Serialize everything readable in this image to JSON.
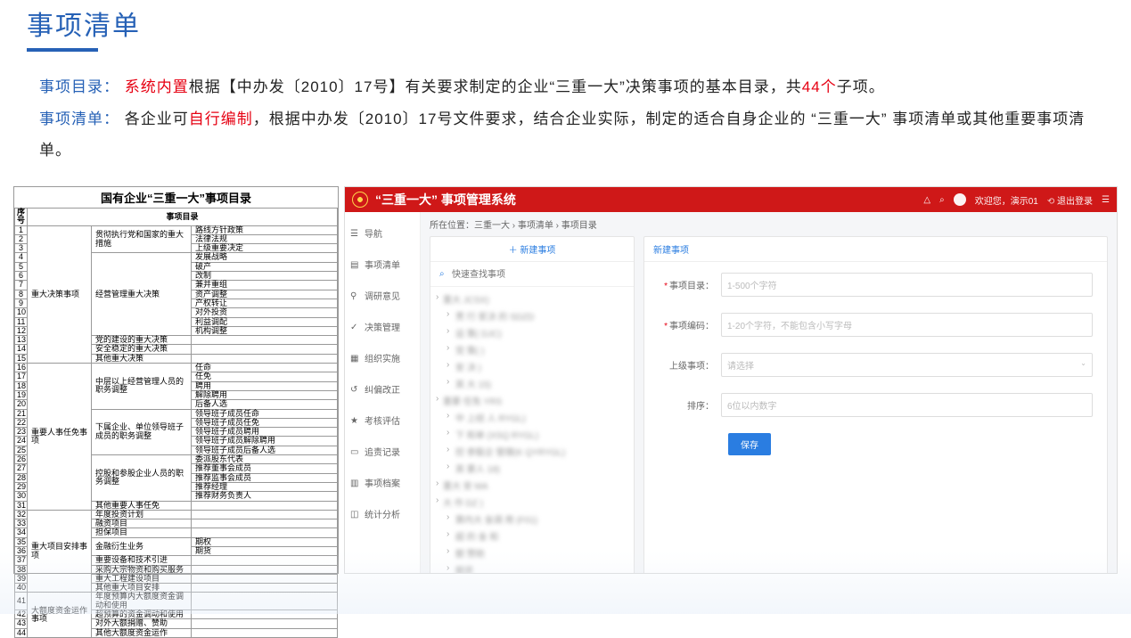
{
  "title": "事项清单",
  "desc": {
    "p1": {
      "label": "事项目录：",
      "red1": "系统内置",
      "t1": "根据【中办发〔2010〕17号】有关要求制定的企业“三重一大”决策事项的基本目录，共",
      "red2": "44个",
      "t2": "子项。"
    },
    "p2": {
      "label": "事项清单：",
      "t1": "各企业可",
      "red1": "自行编制",
      "t2": "，根据中办发〔2010〕17号文件要求，结合企业实际，制定的适合自身企业的 “三重一大” 事项清单或其他重要事项清单。"
    }
  },
  "catalog": {
    "title": "国有企业“三重一大”事项目录",
    "headers": {
      "idx": "序号",
      "items": "事项目录"
    },
    "rows": [
      {
        "i": 1,
        "g1": "重大决策事项",
        "g2": "贯彻执行党和国家的重大措施",
        "it": "路线方针政策"
      },
      {
        "i": 2,
        "it": "法律法规"
      },
      {
        "i": 3,
        "it": "上级重要决定"
      },
      {
        "i": 4,
        "g2": "经营管理重大决策",
        "it": "发展战略"
      },
      {
        "i": 5,
        "it": "破产"
      },
      {
        "i": 6,
        "it": "改制"
      },
      {
        "i": 7,
        "it": "兼并重组"
      },
      {
        "i": 8,
        "it": "资产调整"
      },
      {
        "i": 9,
        "it": "产权转让"
      },
      {
        "i": 10,
        "it": "对外投资"
      },
      {
        "i": 11,
        "it": "利益调配"
      },
      {
        "i": 12,
        "it": "机构调整"
      },
      {
        "i": 13,
        "g2": "党的建设的重大决策",
        "it": ""
      },
      {
        "i": 14,
        "g2": "安全稳定的重大决策",
        "it": ""
      },
      {
        "i": 15,
        "g2": "其他重大决策",
        "it": ""
      },
      {
        "i": 16,
        "g1": "重要人事任免事项",
        "g2": "中层以上经营管理人员的职务调整",
        "it": "任命"
      },
      {
        "i": 17,
        "it": "任免"
      },
      {
        "i": 18,
        "it": "聘用"
      },
      {
        "i": 19,
        "it": "解除聘用"
      },
      {
        "i": 20,
        "it": "后备人选"
      },
      {
        "i": 21,
        "g2": "下属企业、单位领导班子成员的职务调整",
        "it": "领导班子成员任命"
      },
      {
        "i": 22,
        "it": "领导班子成员任免"
      },
      {
        "i": 23,
        "it": "领导班子成员聘用"
      },
      {
        "i": 24,
        "it": "领导班子成员解除聘用"
      },
      {
        "i": 25,
        "it": "领导班子成员后备人选"
      },
      {
        "i": 26,
        "g2": "控股和参股企业人员的职务调整",
        "it": "委派股东代表"
      },
      {
        "i": 27,
        "it": "推荐董事会成员"
      },
      {
        "i": 28,
        "it": "推荐监事会成员"
      },
      {
        "i": 29,
        "it": "推荐经理"
      },
      {
        "i": 30,
        "it": "推荐财务负责人"
      },
      {
        "i": 31,
        "g2": "其他重要人事任免",
        "it": ""
      },
      {
        "i": 32,
        "g1": "重大项目安排事项",
        "g2": "年度投资计划",
        "it": ""
      },
      {
        "i": 33,
        "g2": "融资项目",
        "it": ""
      },
      {
        "i": 34,
        "g2": "担保项目",
        "it": ""
      },
      {
        "i": 35,
        "g2": "金融衍生业务",
        "it": "期权"
      },
      {
        "i": 36,
        "it": "期货"
      },
      {
        "i": 37,
        "g2": "重要设备和技术引进",
        "it": ""
      },
      {
        "i": 38,
        "g2": "采购大宗物资和购买服务",
        "it": ""
      },
      {
        "i": 39,
        "g2": "重大工程建设项目",
        "it": ""
      },
      {
        "i": 40,
        "g2": "其他重大项目安排",
        "it": ""
      },
      {
        "i": 41,
        "g1": "大额度资金运作事项",
        "g2": "年度预算内大额度资金调动和使用",
        "it": ""
      },
      {
        "i": 42,
        "g2": "超预算的资金调动和使用",
        "it": ""
      },
      {
        "i": 43,
        "g2": "对外大额捐赠、赞助",
        "it": ""
      },
      {
        "i": 44,
        "g2": "其他大额度资金运作",
        "it": ""
      }
    ]
  },
  "app": {
    "header": {
      "title": "“三重一大” 事项管理系统",
      "welcome": "欢迎您，演示01",
      "logout": "退出登录"
    },
    "nav": [
      "导航",
      "事项清单",
      "调研意见",
      "决策管理",
      "组织实施",
      "纠偏改正",
      "考核评估",
      "追责记录",
      "事项档案",
      "统计分析"
    ],
    "breadcrumb": "所在位置：三重一大 › 事项清单 › 事项目录",
    "tree": {
      "new_btn": "＋ 新建事项",
      "search_ph": "快速查找事项",
      "nodes": [
        {
          "d": 1,
          "t": "重大         JCSX)"
        },
        {
          "d": 2,
          "t": "贯    行    家决  的          SDZD"
        },
        {
          "d": 2,
          "t": "运         策(       DJC)"
        },
        {
          "d": 2,
          "t": "党         策(   )"
        },
        {
          "d": 2,
          "t": "安        决       )"
        },
        {
          "d": 2,
          "t": "其   大     15)"
        },
        {
          "d": 1,
          "t": "重要    任免    YRS   "
        },
        {
          "d": 2,
          "t": "中   上经    人        RYGL)"
        },
        {
          "d": 2,
          "t": "下     和单        (XSQ    RYGL)"
        },
        {
          "d": 2,
          "t": "控   参股企     管理(K       QYRYGL)"
        },
        {
          "d": 2,
          "t": "其    要人   18)"
        },
        {
          "d": 1,
          "t": "重大    安        MA  "
        },
        {
          "d": 1,
          "t": "大         作    DZ      )"
        },
        {
          "d": 2,
          "t": "算内大     金调     用 (F01)"
        },
        {
          "d": 2,
          "t": "超   的  金   和    "
        },
        {
          "d": 2,
          "t": "额       赞助"
        },
        {
          "d": 2,
          "t": "额资    "
        }
      ]
    },
    "form": {
      "tab": "新建事项",
      "catalog_label": "事项目录：",
      "catalog_ph": "1-500个字符",
      "code_label": "事项编码：",
      "code_ph": "1-20个字符，不能包含小写字母",
      "parent_label": "上级事项：",
      "parent_ph": "请选择",
      "order_label": "排序：",
      "order_ph": "6位以内数字",
      "save": "保存"
    }
  }
}
